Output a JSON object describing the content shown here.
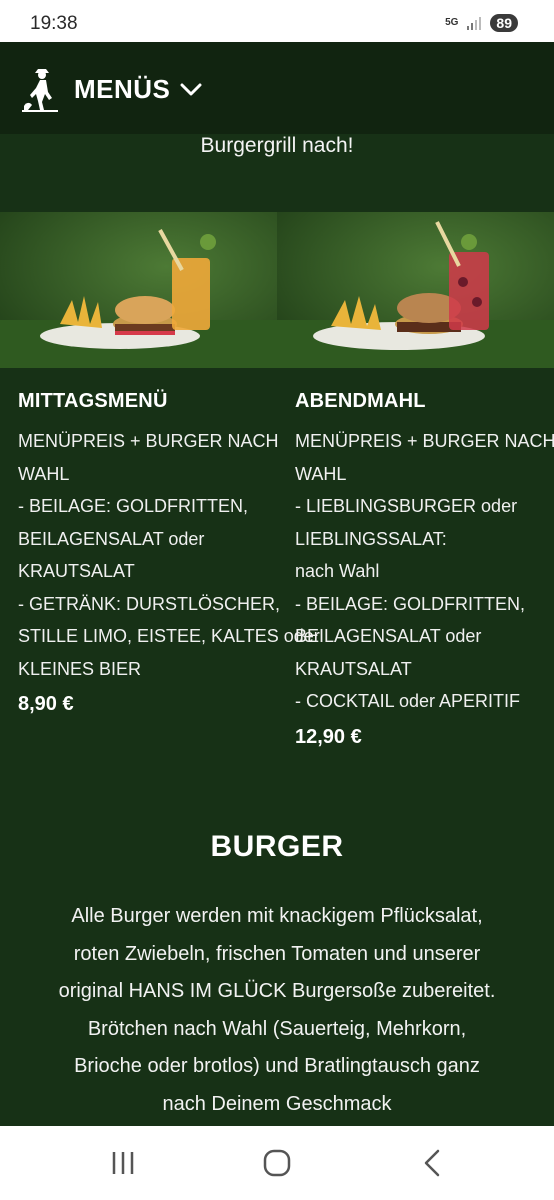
{
  "status_bar": {
    "time": "19:38",
    "network": "5G",
    "battery": "89"
  },
  "header": {
    "logo_icon": "hans-im-glueck-logo-icon",
    "menu_label": "MENÜS",
    "dropdown_icon": "chevron-down-icon"
  },
  "intro": {
    "text": "Burgergrill nach!"
  },
  "menus": [
    {
      "title": "MITTAGSMENÜ",
      "lines": [
        "MENÜPREIS + BURGER NACH",
        "WAHL",
        "- BEILAGE: GOLDFRITTEN,",
        "BEILAGENSALAT oder",
        "KRAUTSALAT",
        "- GETRÄNK: DURSTLÖSCHER,",
        "STILLE LIMO, EISTEE, KALTES oder",
        "KLEINES BIER"
      ],
      "price": "8,90 €"
    },
    {
      "title": "ABENDMAHL",
      "lines": [
        "MENÜPREIS + BURGER NACH",
        "WAHL",
        "- LIEBLINGSBURGER oder",
        "LIEBLINGSSALAT:",
        "nach Wahl",
        "- BEILAGE: GOLDFRITTEN,",
        "BEILAGENSALAT oder",
        "KRAUTSALAT",
        "- COCKTAIL oder APERITIF"
      ],
      "price": "12,90 €"
    }
  ],
  "burger_section": {
    "title": "BURGER",
    "description_lines": [
      "Alle Burger werden mit knackigem Pflücksalat,",
      "roten Zwiebeln, frischen Tomaten und unserer",
      "original HANS IM GLÜCK Burgersoße zubereitet.",
      "Brötchen nach Wahl (Sauerteig, Mehrkorn,",
      "Brioche oder brotlos) und Bratlingtausch ganz",
      "nach Deinem Geschmack"
    ]
  },
  "nav_bar": {
    "recent_icon": "recent-apps-icon",
    "home_icon": "home-icon",
    "back_icon": "back-icon"
  },
  "colors": {
    "background": "#173116",
    "header": "#112410",
    "text": "#ffffff"
  }
}
